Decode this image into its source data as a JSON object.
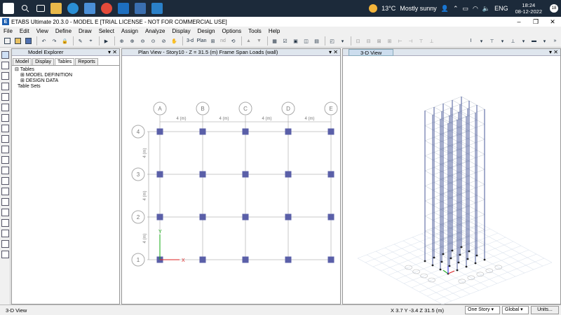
{
  "taskbar": {
    "weather_temp": "13°C",
    "weather_text": "Mostly sunny",
    "language": "ENG",
    "time": "18:24",
    "date": "08-12-2022",
    "notification_count": "18"
  },
  "window": {
    "app_letter": "E",
    "title": "ETABS Ultimate 20.3.0 - MODEL E  [TRIAL LICENSE - NOT FOR COMMERCIAL USE]",
    "controls": [
      "–",
      "❐",
      "✕"
    ]
  },
  "menu": [
    "File",
    "Edit",
    "View",
    "Define",
    "Draw",
    "Select",
    "Assign",
    "Analyze",
    "Display",
    "Design",
    "Options",
    "Tools",
    "Help"
  ],
  "toolbar_text": {
    "three_d": "3-d",
    "plan": "Plan",
    "nd": "nd"
  },
  "explorer": {
    "title": "Model Explorer",
    "tabs": [
      "Model",
      "Display",
      "Tables",
      "Reports"
    ],
    "active_tab": "Tables",
    "tree_root": "Tables",
    "tree_children": [
      "MODEL DEFINITION",
      "DESIGN DATA"
    ],
    "tree_after": "Table Sets"
  },
  "plan_view": {
    "title": "Plan View - Story10 - Z = 31.5 (m)  Frame Span Loads (wall)",
    "grid_columns": [
      "A",
      "B",
      "C",
      "D",
      "E"
    ],
    "grid_rows": [
      "4",
      "3",
      "2",
      "1"
    ],
    "spacing_x": [
      "4 (m)",
      "4 (m)",
      "4 (m)",
      "4 (m)"
    ],
    "spacing_y": [
      "4 (m)",
      "4 (m)",
      "4 (m)"
    ],
    "axis_x_label": "X",
    "axis_y_label": "Y"
  },
  "view_3d": {
    "title": "3-D View"
  },
  "status": {
    "left": "3-D View",
    "coords": "X 3.7  Y -3.4  Z 31.5 (m)",
    "story_select": "One Story",
    "coord_system": "Global",
    "units_button": "Units..."
  },
  "colors": {
    "taskbar": "#1c2a3a",
    "column_node": "#5a5fa8",
    "grid_line": "#c8c8c8",
    "frame_3d": "#4a5a9a"
  }
}
